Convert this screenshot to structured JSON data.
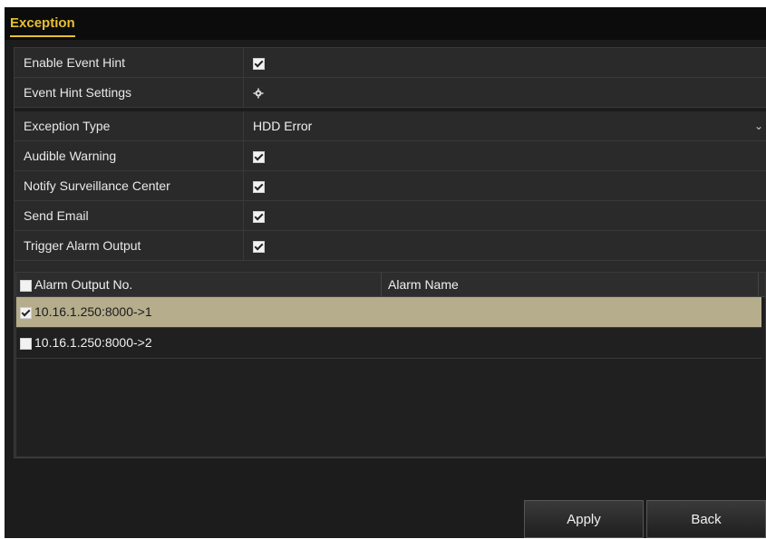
{
  "tab": {
    "label": "Exception"
  },
  "settings": {
    "enable_event_hint": {
      "label": "Enable Event Hint",
      "checked": true
    },
    "event_hint_settings": {
      "label": "Event Hint Settings"
    },
    "exception_type": {
      "label": "Exception Type",
      "value": "HDD Error"
    },
    "audible_warning": {
      "label": "Audible Warning",
      "checked": true
    },
    "notify_surveillance_center": {
      "label": "Notify Surveillance Center",
      "checked": true
    },
    "send_email": {
      "label": "Send Email",
      "checked": true
    },
    "trigger_alarm_output": {
      "label": "Trigger Alarm Output",
      "checked": true
    }
  },
  "alarm_table": {
    "columns": [
      "Alarm Output No.",
      "Alarm Name"
    ],
    "rows": [
      {
        "output": "10.16.1.250:8000->1",
        "name": "",
        "checked": true,
        "selected": true
      },
      {
        "output": "10.16.1.250:8000->2",
        "name": "",
        "checked": false,
        "selected": false
      }
    ]
  },
  "buttons": {
    "apply": "Apply",
    "back": "Back"
  },
  "colors": {
    "accent": "#e9c02f",
    "selected_row": "#b5ad8c",
    "panel": "#2a2a2a"
  }
}
